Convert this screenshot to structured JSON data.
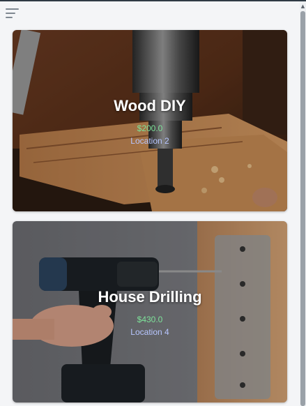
{
  "header": {
    "menu_icon": "hamburger-menu-icon"
  },
  "cards": [
    {
      "title": "Wood DIY",
      "price": "$200.0",
      "location": "Location 2",
      "image": "drill-press-on-wood-photo"
    },
    {
      "title": "House Drilling",
      "price": "$430.0",
      "location": "Location 4",
      "image": "cordless-drill-on-wood-wall-photo"
    }
  ],
  "colors": {
    "price": "#7ee29a",
    "location": "#b7c6ff",
    "title": "#ffffff"
  }
}
